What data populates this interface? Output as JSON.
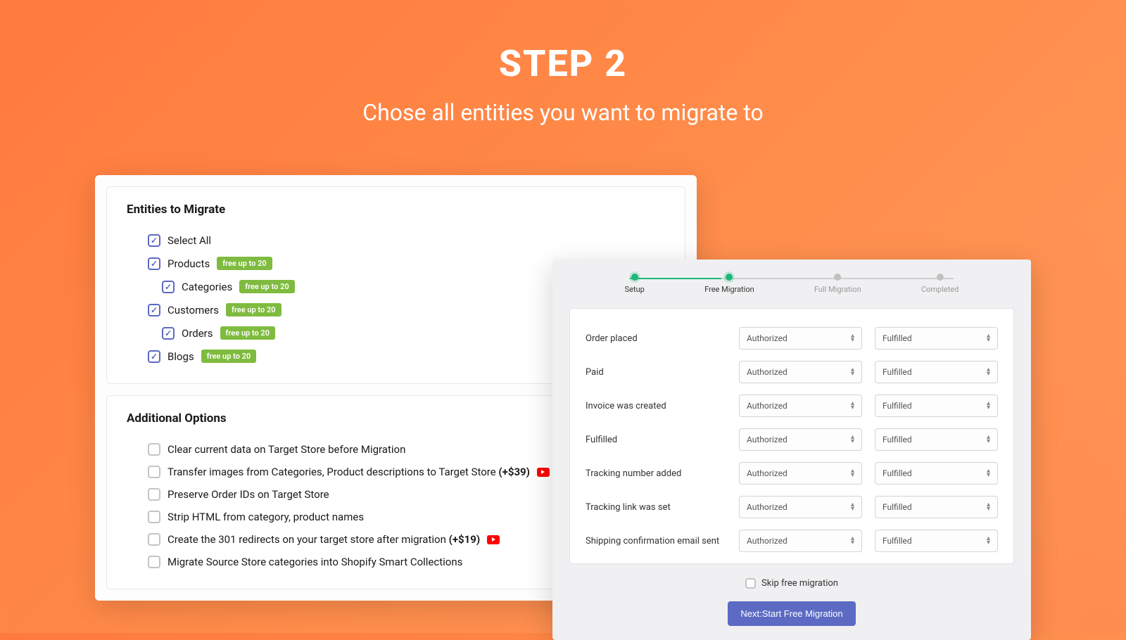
{
  "header": {
    "title": "STEP 2",
    "subtitle": "Chose all entities you want to migrate to"
  },
  "entities": {
    "title": "Entities to Migrate",
    "badge_text": "free up to 20",
    "items": [
      {
        "label": "Select All",
        "checked": true,
        "indent": false,
        "badge": false
      },
      {
        "label": "Products",
        "checked": true,
        "indent": false,
        "badge": true
      },
      {
        "label": "Categories",
        "checked": true,
        "indent": true,
        "badge": true
      },
      {
        "label": "Customers",
        "checked": true,
        "indent": false,
        "badge": true
      },
      {
        "label": "Orders",
        "checked": true,
        "indent": true,
        "badge": true
      },
      {
        "label": "Blogs",
        "checked": true,
        "indent": false,
        "badge": true
      }
    ]
  },
  "options": {
    "title": "Additional Options",
    "items": [
      {
        "label": "Clear current data on Target Store before Migration",
        "price": "",
        "video": false
      },
      {
        "label": "Transfer images from Categories, Product descriptions to Target Store",
        "price": "(+$39)",
        "video": true
      },
      {
        "label": "Preserve Order IDs on Target Store",
        "price": "",
        "video": false
      },
      {
        "label": "Strip HTML from category, product names",
        "price": "",
        "video": false
      },
      {
        "label": "Create the 301 redirects on your target store after migration",
        "price": "(+$19)",
        "video": true
      },
      {
        "label": "Migrate Source Store categories into Shopify Smart Collections",
        "price": "",
        "video": false
      }
    ]
  },
  "wizard": {
    "steps": [
      {
        "label": "Setup",
        "state": "done"
      },
      {
        "label": "Free Migration",
        "state": "done"
      },
      {
        "label": "Full Migration",
        "state": ""
      },
      {
        "label": "Completed",
        "state": ""
      }
    ],
    "rows": [
      {
        "label": "Order placed",
        "sel1": "Authorized",
        "sel2": "Fulfilled"
      },
      {
        "label": "Paid",
        "sel1": "Authorized",
        "sel2": "Fulfilled"
      },
      {
        "label": "Invoice was created",
        "sel1": "Authorized",
        "sel2": "Fulfilled"
      },
      {
        "label": "Fulfilled",
        "sel1": "Authorized",
        "sel2": "Fulfilled"
      },
      {
        "label": "Tracking number added",
        "sel1": "Authorized",
        "sel2": "Fulfilled"
      },
      {
        "label": "Tracking link was set",
        "sel1": "Authorized",
        "sel2": "Fulfilled"
      },
      {
        "label": "Shipping confirmation email sent",
        "sel1": "Authorized",
        "sel2": "Fulfilled"
      }
    ],
    "skip_label": "Skip free migration",
    "next_label": "Next:Start Free Migration"
  }
}
